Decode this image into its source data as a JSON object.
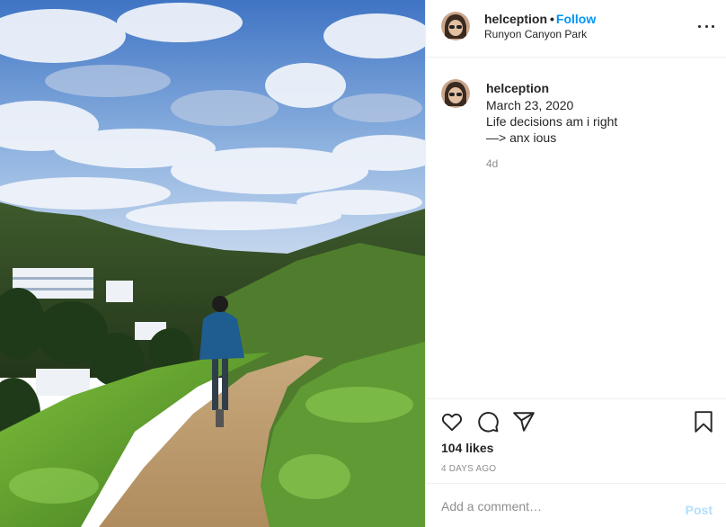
{
  "post": {
    "image_alt": "Woman walking on a dirt trail in Runyon Canyon"
  },
  "header": {
    "username": "helception",
    "separator": "•",
    "follow_label": "Follow",
    "location": "Runyon Canyon Park",
    "more_icon": "more-options-icon"
  },
  "caption": {
    "username": "helception",
    "text": "March 23, 2020\nLife decisions am i right\n—> anx ious",
    "time": "4d"
  },
  "actions": {
    "icons": [
      "heart-icon",
      "comment-icon",
      "share-icon",
      "bookmark-icon"
    ]
  },
  "likes": "104 likes",
  "time_ago": "4 DAYS AGO",
  "comment_box": {
    "placeholder": "Add a comment…",
    "post_label": "Post"
  },
  "colors": {
    "follow": "#0095f6",
    "post_disabled": "#b2dffc",
    "muted": "#8e8e8e",
    "text": "#262626"
  }
}
